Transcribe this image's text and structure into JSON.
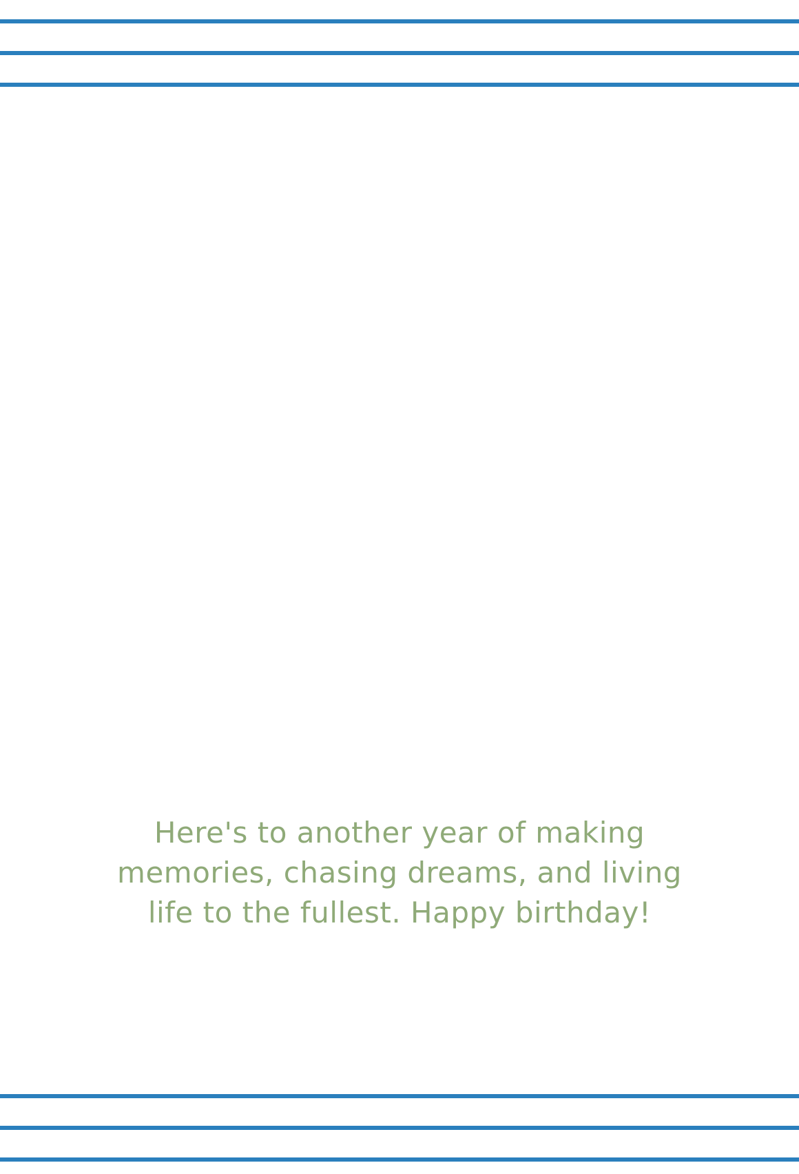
{
  "colors": {
    "stripe": "#2a7fbd",
    "message_text": "#8faa78",
    "background": "#ffffff"
  },
  "message": {
    "lines": [
      "Here's to another year of making",
      "memories, chasing dreams, and living",
      "life to the fullest. Happy birthday!"
    ]
  }
}
